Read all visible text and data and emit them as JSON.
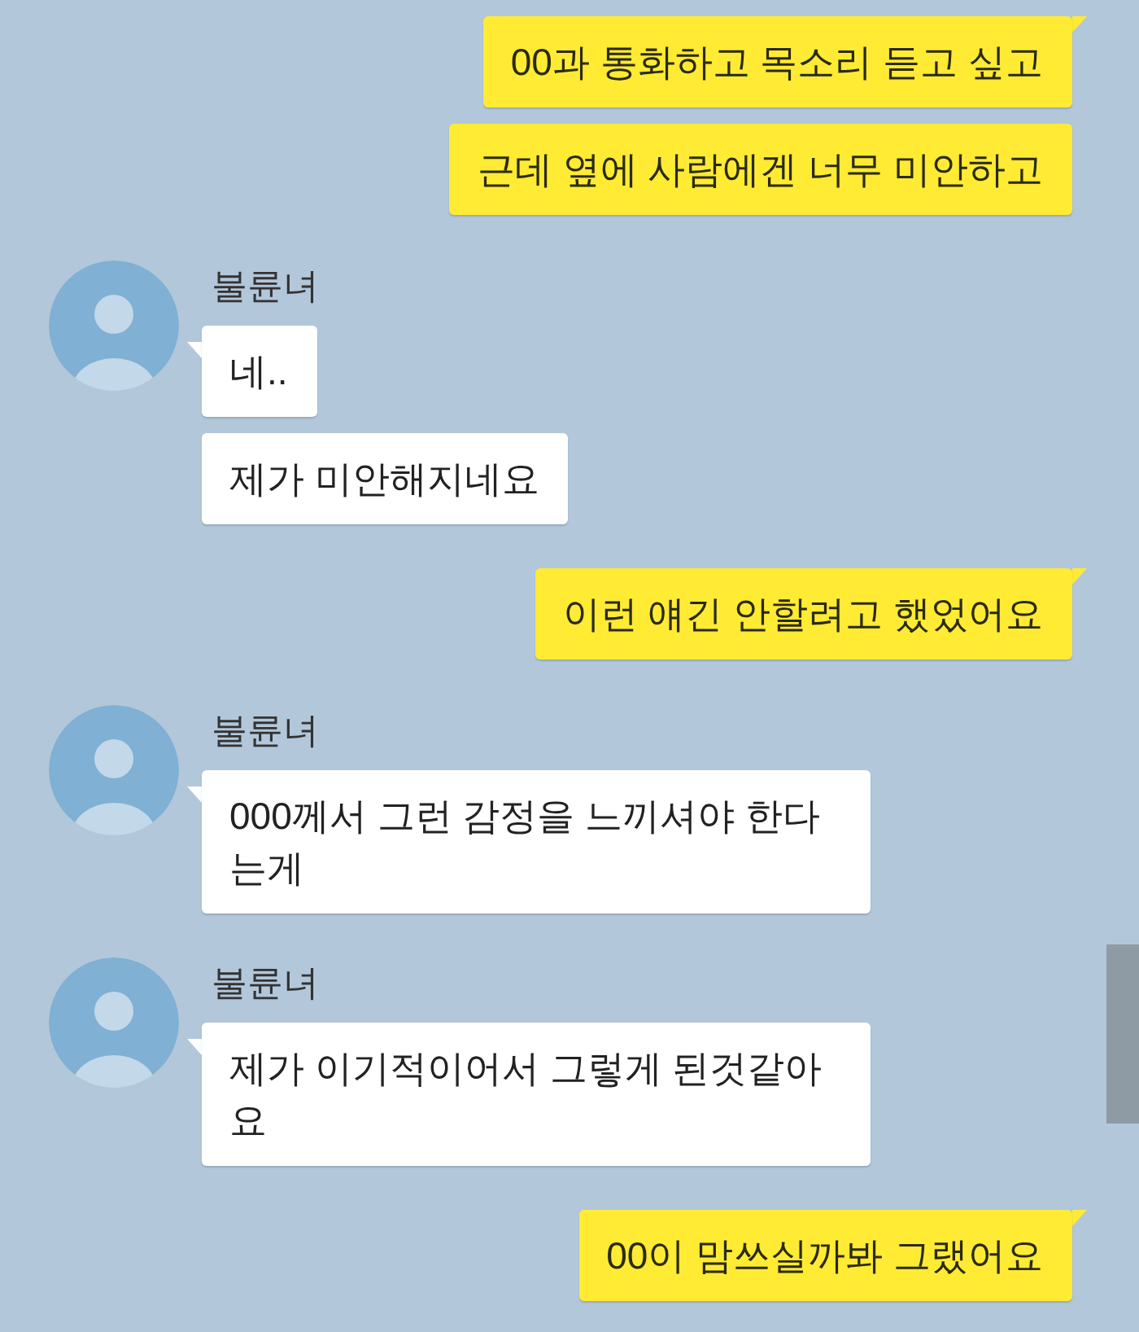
{
  "groups": [
    {
      "kind": "sent",
      "messages": [
        "00과 통화하고 목소리 듣고 싶고",
        "근데 옆에 사람에겐 너무 미안하고"
      ]
    },
    {
      "kind": "received",
      "sender": "불륜녀",
      "messages": [
        "네..",
        "제가 미안해지네요"
      ]
    },
    {
      "kind": "sent",
      "messages": [
        "이런 얘긴 안할려고 했었어요"
      ]
    },
    {
      "kind": "received",
      "sender": "불륜녀",
      "messages": [
        "000께서 그런 감정을 느끼셔야 한다는게"
      ]
    },
    {
      "kind": "received",
      "sender": "불륜녀",
      "messages": [
        "제가 이기적이어서 그렇게 된것같아요"
      ]
    },
    {
      "kind": "sent",
      "messages": [
        "00이 맘쓰실까봐 그랬어요"
      ]
    }
  ]
}
